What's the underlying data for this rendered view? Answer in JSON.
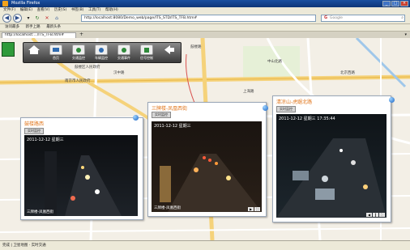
{
  "window": {
    "title": "Mozilla Firefox"
  },
  "menu": [
    "文件(F)",
    "编辑(E)",
    "查看(V)",
    "历史(S)",
    "书签(B)",
    "工具(T)",
    "帮助(H)"
  ],
  "address": {
    "url": "http://localhost:8080/Demo_web/page/ITS_STD/ITS_TFB.htm#"
  },
  "search": {
    "placeholder": "Google"
  },
  "bookmarks": [
    "访问最多",
    "新手上路",
    "最新头条"
  ],
  "tab": {
    "label": "http://localhost:.../ITS_TFB.htm#"
  },
  "toolbar": {
    "items": [
      "首页",
      "交通监控",
      "车辆监控",
      "交通事件",
      "信号控制",
      "返回"
    ]
  },
  "map_labels": [
    "鼓楼路",
    "中山北路",
    "北京西路",
    "汉中路",
    "鼓楼区人民政府",
    "南京市人民政府",
    "上海路",
    "中山路"
  ],
  "panels": [
    {
      "title": "鼓楼路西",
      "button": "实时监控",
      "timestamp": "2011-12-12 星期三",
      "caption": "三牌楼-凤凰西街"
    },
    {
      "title": "三牌楼-凤凰西街",
      "button": "实时监控",
      "timestamp": "2011-12-12 星期三",
      "caption": "三牌楼-凤凰西街"
    },
    {
      "title": "清凉山-虎踞北路",
      "button": "实时监控",
      "timestamp": "2011-12-12 星期三 17:35:44",
      "caption": ""
    }
  ],
  "status": {
    "text": "完成 | 卫星地图 · 实时交通"
  },
  "colors": {
    "accent": "#e1781f",
    "titlebar": "#1a4fa0"
  }
}
